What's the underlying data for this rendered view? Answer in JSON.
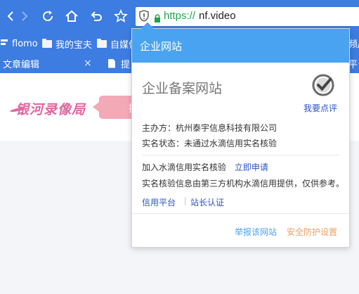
{
  "browser": {
    "url_scheme": "https://",
    "url_host": "nf.video"
  },
  "bookmarks": [
    {
      "label": "flomo",
      "icon": "flomo-icon"
    },
    {
      "label": "我的宝夫",
      "icon": "folder-icon"
    },
    {
      "label": "自媒体",
      "icon": "folder-icon"
    },
    {
      "label": "频/头",
      "icon": "none"
    }
  ],
  "tabs": [
    {
      "label": "文章编辑",
      "close": "×"
    },
    {
      "label": "提",
      "icon": "doc-icon"
    },
    {
      "label": "平台",
      "icon": "none"
    }
  ],
  "page": {
    "logo_text": "银河录像局",
    "bubble_text": "提"
  },
  "popup": {
    "header_title": "企业网站",
    "cert_title": "企业备案网站",
    "review_link": "我要点评",
    "sponsor": "主办方：杭州泰宇信息科技有限公司",
    "verify_status": "实名状态：未通过水滴信用实名核验",
    "join_text": "加入水滴信用实名核验",
    "apply_link": "立即申请",
    "disclaimer": "实名核验信息由第三方机构水滴信用提供，仅供参考。",
    "credit_platform": "信用平台",
    "webmaster_cert": "站长认证",
    "report_link": "举报该网站",
    "security_settings": "安全防护设置"
  },
  "colors": {
    "chrome_blue": "#3d7ce0",
    "popup_header": "#4aa3f0",
    "link_blue": "#2a52c8",
    "report_blue": "#4aa3f0",
    "security_orange": "#f0a060",
    "logo_pink": "#e0679f",
    "url_green": "#1da64a"
  }
}
